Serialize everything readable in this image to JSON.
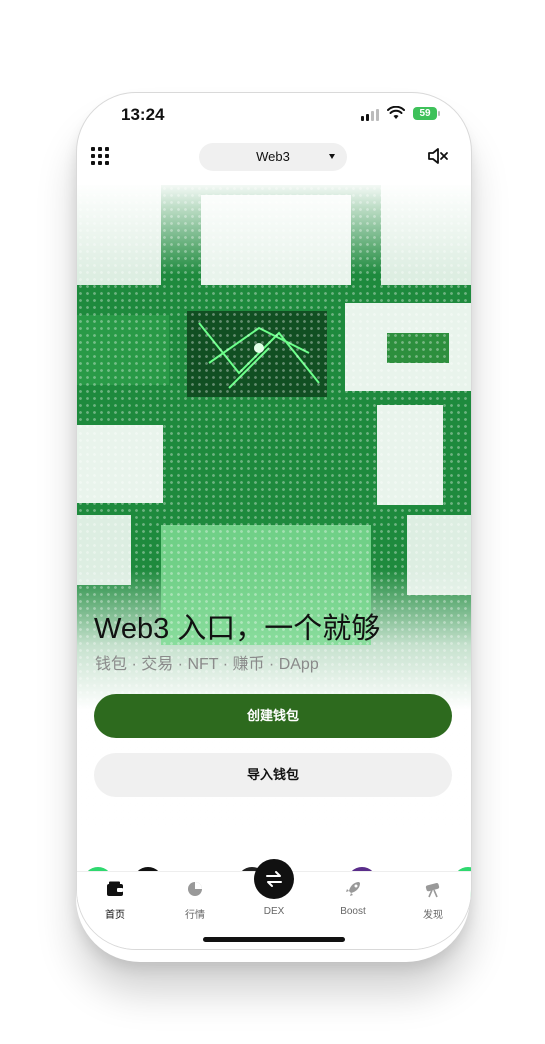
{
  "status_bar": {
    "time": "13:24",
    "battery": "59"
  },
  "header": {
    "network": "Web3"
  },
  "hero": {
    "headline": "Web3 入口，一个就够",
    "subline": "钱包 · 交易 · NFT · 赚币 · DApp"
  },
  "actions": {
    "create_wallet": "创建钱包",
    "import_wallet": "导入钱包"
  },
  "tabs": [
    {
      "label": "首页",
      "icon": "wallet-icon"
    },
    {
      "label": "行情",
      "icon": "market-icon"
    },
    {
      "label": "DEX",
      "icon": "swap-icon"
    },
    {
      "label": "Boost",
      "icon": "rocket-icon"
    },
    {
      "label": "发现",
      "icon": "telescope-icon"
    }
  ],
  "colors": {
    "primary_green": "#2d6a1e",
    "hero_green": "#1e8a3d",
    "battery_green": "#3ec15a"
  }
}
